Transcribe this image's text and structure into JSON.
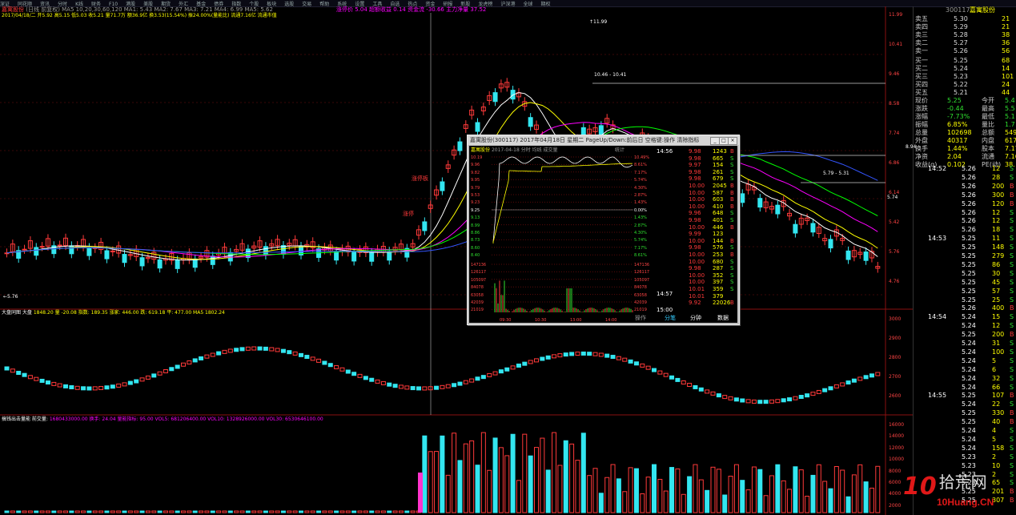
{
  "top_menu": [
    "深证",
    "同花顺",
    "资讯",
    "分时",
    "K线",
    "财务",
    "F10",
    "港股",
    "美股",
    "期货",
    "外汇",
    "基金",
    "债券",
    "指数",
    "个股",
    "板块",
    "选股",
    "交易",
    "帮助",
    "系统",
    "设置",
    "工具",
    "自选",
    "热点",
    "资金",
    "研报",
    "新股",
    "龙虎榜",
    "沪深港",
    "全球",
    "期权"
  ],
  "chart_header": {
    "name": "嘉寓股份",
    "line1_rest": "(日线 前复权) MA5 10,20,30,60,120 MA1: 5.43 MA2: 7.67 MA3: 7.21 MA4: 6.99 MA5: 5.62",
    "line1_right": "涨停价 5.04  超额收益 0.14  资金流 -30.66  主力净量 37.52",
    "line2": "2017/04/18/二 开5.92 高5.15 低5.03 收5.21 量71.7万 额36.9亿 换3.53(15.54%) 振24.00%(量能比) 流通7.16亿 流通市值"
  },
  "price_axis": [
    "11.99",
    "10.41",
    "9.46",
    "8.58",
    "7.74",
    "6.86",
    "6.14",
    "5.42",
    "5.76",
    "4.76"
  ],
  "price_labels": {
    "high": "11.99",
    "band": "10.46 - 10.41",
    "ref1": "8.94",
    "ref2": "5.79 - 5.31",
    "ref3": "5.74",
    "low": "5.76"
  },
  "volume_panel1": {
    "title": "大盘同图 大盘",
    "values": "1848.20 量 -20.08 指数: 189.35 涨家: 446.00 跌: 619.18 平: 477.00 MA5 1802.24"
  },
  "volume_panel2": {
    "title": "搞钱出击量能 前交量:",
    "values": "1680433000.00 换手: 24.04 量能指标: 95.00 VOL5: 681206400.00 VOL10: 1328926000.00 VOL30: 6530646100.00"
  },
  "sub_axis1": [
    "3000",
    "2900",
    "2800",
    "2700",
    "2600"
  ],
  "sub_axis2": [
    "16000",
    "14000",
    "12000",
    "10000",
    "8000",
    "6000",
    "4000",
    "2000"
  ],
  "side": {
    "code": "300117",
    "name": "嘉寓股份",
    "asks": [
      {
        "label": "卖五",
        "price": "5.30",
        "vol": "21"
      },
      {
        "label": "卖四",
        "price": "5.29",
        "vol": "21"
      },
      {
        "label": "卖三",
        "price": "5.28",
        "vol": "38"
      },
      {
        "label": "卖二",
        "price": "5.27",
        "vol": "36"
      },
      {
        "label": "卖一",
        "price": "5.26",
        "vol": "56"
      }
    ],
    "bids": [
      {
        "label": "买一",
        "price": "5.25",
        "vol": "68"
      },
      {
        "label": "买二",
        "price": "5.24",
        "vol": "14"
      },
      {
        "label": "买三",
        "price": "5.23",
        "vol": "101"
      },
      {
        "label": "买四",
        "price": "5.22",
        "vol": "24"
      },
      {
        "label": "买五",
        "price": "5.21",
        "vol": "44"
      }
    ],
    "stats": [
      {
        "k1": "现价",
        "v1": "5.25",
        "k2": "今开",
        "v2": "5.4"
      },
      {
        "k1": "涨跌",
        "v1": "-0.44",
        "k2": "最高",
        "v2": "5.5"
      },
      {
        "k1": "涨幅",
        "v1": "-7.73%",
        "k2": "最低",
        "v2": "5.1"
      },
      {
        "k1": "振幅",
        "v1": "6.85%",
        "k2": "量比",
        "v2": "1.7"
      },
      {
        "k1": "总量",
        "v1": "102698",
        "k2": "总额",
        "v2": "5499"
      },
      {
        "k1": "外盘",
        "v1": "40317",
        "k2": "内盘",
        "v2": "6179"
      },
      {
        "k1": "换手",
        "v1": "1.44%",
        "k2": "股本",
        "v2": "7.17"
      },
      {
        "k1": "净资",
        "v1": "2.04",
        "k2": "流通",
        "v2": "7.16"
      },
      {
        "k1": "收益(q)",
        "v1": "0.102",
        "k2": "PE(动)",
        "v2": "38."
      }
    ],
    "ticks": [
      {
        "t": "14:52",
        "p": "5.26",
        "v": "12",
        "d": "S"
      },
      {
        "t": "",
        "p": "5.26",
        "v": "28",
        "d": "S"
      },
      {
        "t": "",
        "p": "5.26",
        "v": "200",
        "d": "B"
      },
      {
        "t": "",
        "p": "5.26",
        "v": "300",
        "d": "B"
      },
      {
        "t": "",
        "p": "5.26",
        "v": "120",
        "d": "B"
      },
      {
        "t": "",
        "p": "5.26",
        "v": "12",
        "d": "S"
      },
      {
        "t": "",
        "p": "5.26",
        "v": "12",
        "d": "S"
      },
      {
        "t": "",
        "p": "5.26",
        "v": "18",
        "d": "S"
      },
      {
        "t": "14:53",
        "p": "5.25",
        "v": "11",
        "d": "S"
      },
      {
        "t": "",
        "p": "5.25",
        "v": "148",
        "d": "S"
      },
      {
        "t": "",
        "p": "5.25",
        "v": "279",
        "d": "S"
      },
      {
        "t": "",
        "p": "5.25",
        "v": "86",
        "d": "S"
      },
      {
        "t": "",
        "p": "5.25",
        "v": "30",
        "d": "S"
      },
      {
        "t": "",
        "p": "5.25",
        "v": "45",
        "d": "S"
      },
      {
        "t": "",
        "p": "5.25",
        "v": "57",
        "d": "S"
      },
      {
        "t": "",
        "p": "5.25",
        "v": "25",
        "d": "S"
      },
      {
        "t": "",
        "p": "5.26",
        "v": "400",
        "d": "B"
      },
      {
        "t": "14:54",
        "p": "5.24",
        "v": "15",
        "d": "S"
      },
      {
        "t": "",
        "p": "5.24",
        "v": "12",
        "d": "S"
      },
      {
        "t": "",
        "p": "5.25",
        "v": "200",
        "d": "B"
      },
      {
        "t": "",
        "p": "5.24",
        "v": "31",
        "d": "S"
      },
      {
        "t": "",
        "p": "5.24",
        "v": "100",
        "d": "S"
      },
      {
        "t": "",
        "p": "5.24",
        "v": "5",
        "d": "S"
      },
      {
        "t": "",
        "p": "5.24",
        "v": "6",
        "d": "S"
      },
      {
        "t": "",
        "p": "5.24",
        "v": "32",
        "d": "S"
      },
      {
        "t": "",
        "p": "5.24",
        "v": "66",
        "d": "S"
      },
      {
        "t": "14:55",
        "p": "5.25",
        "v": "107",
        "d": "B"
      },
      {
        "t": "",
        "p": "5.24",
        "v": "22",
        "d": "S"
      },
      {
        "t": "",
        "p": "5.25",
        "v": "330",
        "d": "B"
      },
      {
        "t": "",
        "p": "5.25",
        "v": "40",
        "d": "B"
      },
      {
        "t": "",
        "p": "5.24",
        "v": "4",
        "d": "S"
      },
      {
        "t": "",
        "p": "5.24",
        "v": "5",
        "d": "S"
      },
      {
        "t": "",
        "p": "5.24",
        "v": "158",
        "d": "S"
      },
      {
        "t": "",
        "p": "5.23",
        "v": "2",
        "d": "S"
      },
      {
        "t": "",
        "p": "5.23",
        "v": "10",
        "d": "S"
      },
      {
        "t": "",
        "p": "5.23",
        "v": "2",
        "d": "S"
      },
      {
        "t": "",
        "p": "5.23",
        "v": "65",
        "d": "S"
      },
      {
        "t": "",
        "p": "5.25",
        "v": "201",
        "d": "B"
      },
      {
        "t": "",
        "p": "5.25",
        "v": "307",
        "d": "B"
      }
    ]
  },
  "popup": {
    "title": "嘉寓股份(300117) 2017年04月18日 星期二 PageUp/Down:前后日 空格键:操作 清除指标",
    "btn_min": "_",
    "btn_max": "□",
    "btn_close": "×",
    "inner_title": "嘉寓股份",
    "inner_sub": "2017-04-18 分时 均线 成交量",
    "inner_right": "统计",
    "left_axis": [
      "10.19",
      "9.96",
      "9.82",
      "9.95",
      "9.79",
      "9.53",
      "9.23",
      "9.25",
      "9.13",
      "8.99",
      "8.86",
      "8.73",
      "8.60",
      "8.40"
    ],
    "right_axis": [
      "10.49%",
      "8.61%",
      "7.17%",
      "5.74%",
      "4.30%",
      "2.87%",
      "1.43%",
      "0.00%",
      "1.43%",
      "2.87%",
      "4.30%",
      "5.74%",
      "7.17%",
      "8.61%"
    ],
    "vol_axis": [
      "147136",
      "126117",
      "105097",
      "84078",
      "63058",
      "42039",
      "21019"
    ],
    "times": [
      "09:30",
      "10:30",
      "13:00",
      "14:00"
    ],
    "tick_times": {
      "a": "14:56",
      "b": "14:57",
      "c": "15:00"
    },
    "ticks": [
      {
        "p": "9.98",
        "v": "1243",
        "d": "B"
      },
      {
        "p": "9.98",
        "v": "665",
        "d": "S"
      },
      {
        "p": "9.97",
        "v": "154",
        "d": "S"
      },
      {
        "p": "9.98",
        "v": "261",
        "d": "S"
      },
      {
        "p": "9.98",
        "v": "679",
        "d": "S"
      },
      {
        "p": "10.00",
        "v": "2045",
        "d": "B"
      },
      {
        "p": "10.00",
        "v": "587",
        "d": "B"
      },
      {
        "p": "10.00",
        "v": "603",
        "d": "B"
      },
      {
        "p": "10.00",
        "v": "410",
        "d": "B"
      },
      {
        "p": "9.96",
        "v": "648",
        "d": "S"
      },
      {
        "p": "9.98",
        "v": "401",
        "d": "S"
      },
      {
        "p": "10.00",
        "v": "446",
        "d": "B"
      },
      {
        "p": "9.99",
        "v": "123",
        "d": ""
      },
      {
        "p": "10.00",
        "v": "144",
        "d": "B"
      },
      {
        "p": "9.98",
        "v": "576",
        "d": "S"
      },
      {
        "p": "10.00",
        "v": "253",
        "d": "B"
      },
      {
        "p": "10.00",
        "v": "680",
        "d": "S"
      },
      {
        "p": "9.98",
        "v": "287",
        "d": "S"
      },
      {
        "p": "10.00",
        "v": "352",
        "d": "S"
      },
      {
        "p": "10.00",
        "v": "397",
        "d": "S"
      },
      {
        "p": "10.01",
        "v": "359",
        "d": "S"
      },
      {
        "p": "10.01",
        "v": "379",
        "d": ""
      },
      {
        "p": "9.92",
        "v": "22026",
        "d": "B"
      }
    ],
    "bottom_left": "操作",
    "tabs": [
      "分笔",
      "分钟",
      "数据"
    ]
  },
  "markers": [
    "涨停板",
    "涨停",
    "+5.76",
    "背",
    "背",
    "背",
    "背",
    "背",
    "背"
  ],
  "watermark": {
    "num": "10",
    "cn": "拾荒网",
    "url": "10Huang.CN"
  },
  "colors": {
    "up": "#ff3a3a",
    "down": "#33e6f0",
    "bg": "#000000",
    "grid": "#8a1010"
  }
}
